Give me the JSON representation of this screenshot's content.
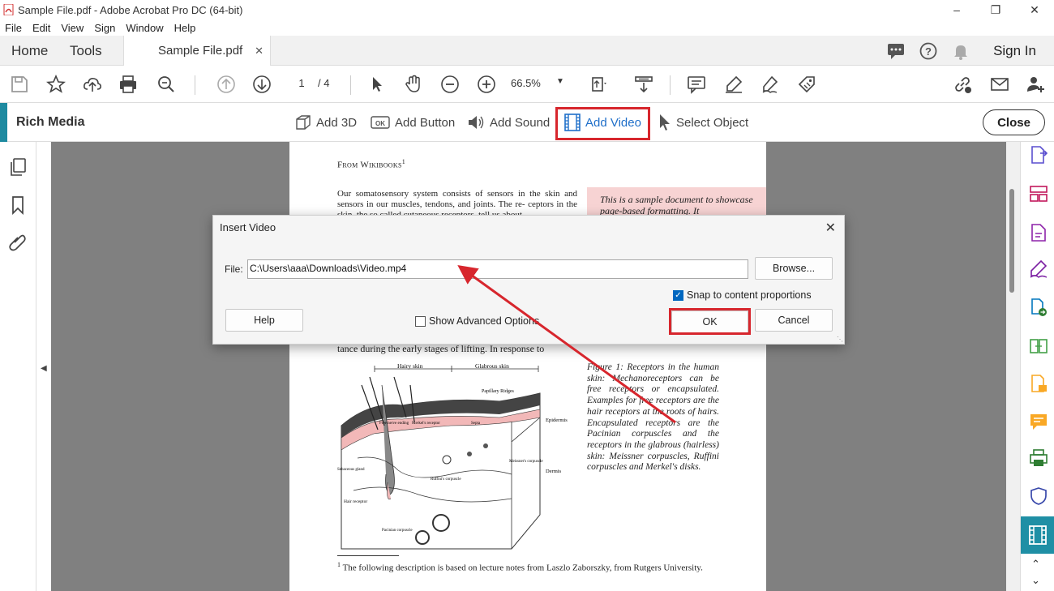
{
  "window": {
    "title": "Sample File.pdf - Adobe Acrobat Pro DC (64-bit)"
  },
  "menu": [
    "File",
    "Edit",
    "View",
    "Sign",
    "Window",
    "Help"
  ],
  "tabs": {
    "home": "Home",
    "tools": "Tools",
    "doc": "Sample File.pdf",
    "sign_in": "Sign In"
  },
  "toolbar": {
    "page_current": "1",
    "page_total": "/ 4",
    "zoom": "66.5%"
  },
  "rich_media": {
    "title": "Rich Media",
    "tools": [
      "Add 3D",
      "Add Button",
      "Add Sound",
      "Add Video",
      "Select Object"
    ],
    "close": "Close"
  },
  "document": {
    "heading": "From Wikibooks",
    "heading_sup": "1",
    "para": "Our somatosensory system consists of sensors in the skin and sensors in our muscles, tendons, and joints. The re- ceptors in the skin, the so called cutaneous receptors, tell us about",
    "pinkbox": "This is a sample document to showcase page-based formatting. It",
    "para2": "tance during the early stages of lifting. In response to",
    "figure_labels": {
      "hairy_skin": "Hairy skin",
      "glabrous_skin": "Glabrous skin",
      "papillary_ridges": "Papillary Ridges",
      "septa": "Septa",
      "epidermis": "Epidermis",
      "dermis": "Dermis",
      "free_nerve": "Free nerve ending",
      "merkel": "Merkel's receptor",
      "sebaceous": "Sebaceous gland",
      "ruffini": "Ruffini's corpuscle",
      "meissner": "Meissner's corpuscle",
      "hair_receptor": "Hair receptor",
      "pacinian": "Pacinian corpuscle"
    },
    "caption": "Figure 1: Receptors in the human skin: Mechanoreceptors can be free receptors or encapsulated. Examples for free receptors are the hair receptors at the roots of hairs. Encapsulated receptors are the Pacinian corpuscles and the receptors in the glabrous (hairless) skin: Meissner corpuscles, Ruffini corpuscles and Merkel's disks.",
    "footnote_num": "1",
    "footnote": "The following description is based on lecture notes from Laszlo Zaborszky, from Rutgers University."
  },
  "dialog": {
    "title": "Insert Video",
    "file_label": "File:",
    "file_value": "C:\\Users\\aaa\\Downloads\\Video.mp4",
    "browse": "Browse...",
    "snap": "Snap to content proportions",
    "snap_checked": true,
    "help": "Help",
    "advanced": "Show Advanced Options",
    "advanced_checked": false,
    "ok": "OK",
    "cancel": "Cancel"
  },
  "colors": {
    "highlight": "#d7262d",
    "accent": "#1e8aa0",
    "active_link": "#1f6fc9"
  }
}
